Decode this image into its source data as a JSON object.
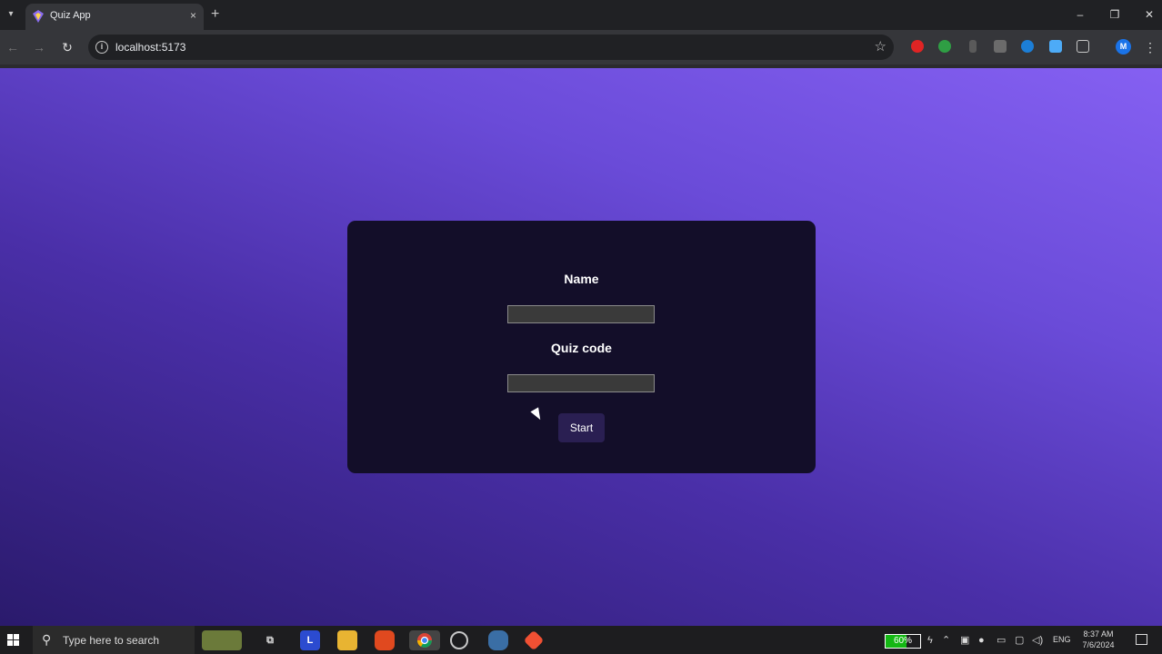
{
  "browser": {
    "tab_title": "Quiz App",
    "tab_close": "×",
    "new_tab": "+",
    "url": "localhost:5173",
    "profile_initial": "M",
    "window_minimize": "–",
    "window_maximize": "❐",
    "window_close": "✕"
  },
  "form": {
    "name_label": "Name",
    "name_value": "",
    "quiz_code_label": "Quiz code",
    "quiz_code_value": "",
    "start_label": "Start"
  },
  "taskbar": {
    "search_placeholder": "Type here to search",
    "battery_percent": "60%",
    "battery_level": 0.6,
    "language": "ENG",
    "time": "8:37 AM",
    "date": "7/6/2024"
  },
  "colors": {
    "card_bg": "#130e29",
    "gradient_start": "#2a1a6c",
    "gradient_end": "#8560f2",
    "button_bg": "#2a1f52"
  }
}
